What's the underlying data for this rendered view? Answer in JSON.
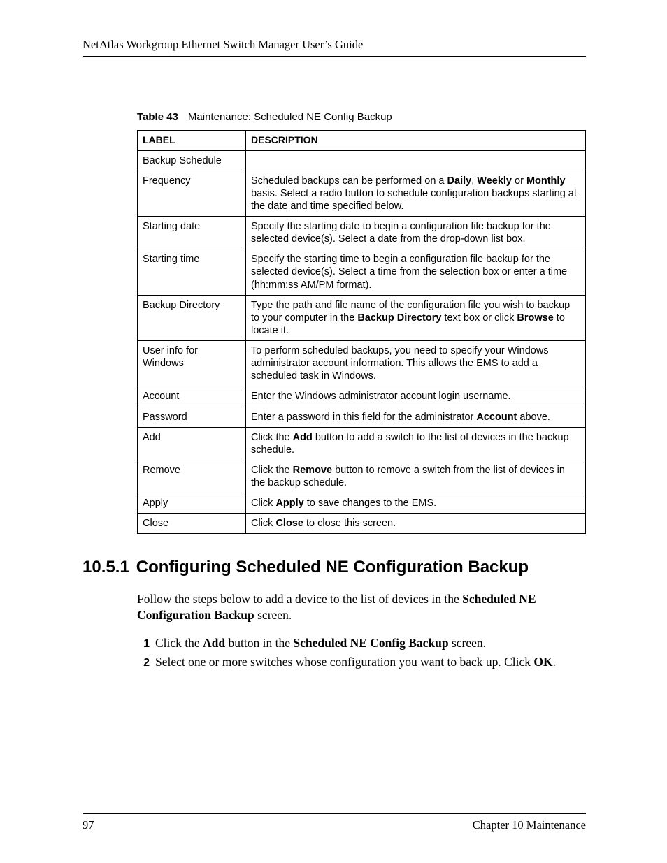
{
  "header": {
    "running": "NetAtlas Workgroup Ethernet Switch Manager User’s Guide"
  },
  "table": {
    "caption_prefix": "Table 43",
    "caption_text": "Maintenance: Scheduled NE Config Backup",
    "headers": {
      "label": "LABEL",
      "description": "DESCRIPTION"
    },
    "rows": [
      {
        "label": "Backup Schedule",
        "desc_html": ""
      },
      {
        "label": "Frequency",
        "desc_html": "Scheduled backups can be performed on a <span class='b'>Daily</span>, <span class='b'>Weekly</span> or <span class='b'>Monthly</span> basis. Select a radio button to schedule configuration backups starting at the date and time specified below."
      },
      {
        "label": "Starting date",
        "desc_html": "Specify the starting date to begin a configuration file backup for the selected device(s). Select a date from the drop-down list box."
      },
      {
        "label": "Starting time",
        "desc_html": "Specify the starting time to begin a configuration file backup for the selected device(s). Select a time from the selection box or enter a time (hh:mm:ss AM/PM format)."
      },
      {
        "label": "Backup Directory",
        "desc_html": "Type the path and file name of the configuration file you wish to backup to your computer in the <span class='b'>Backup Directory</span> text box or click <span class='b'>Browse</span> to locate it."
      },
      {
        "label": "User info for Windows",
        "desc_html": "To perform scheduled backups, you need to specify your Windows administrator account information. This allows the EMS to add a scheduled task in Windows."
      },
      {
        "label": "Account",
        "desc_html": "Enter the Windows administrator account login username."
      },
      {
        "label": "Password",
        "desc_html": "Enter a password in this field for the administrator <span class='b'>Account</span> above."
      },
      {
        "label": "Add",
        "desc_html": "Click the <span class='b'>Add</span> button to add a switch to the list of devices in the backup schedule."
      },
      {
        "label": "Remove",
        "desc_html": "Click the <span class='b'>Remove</span> button to remove a switch from the list of devices in the backup schedule."
      },
      {
        "label": "Apply",
        "desc_html": "Click <span class='b'>Apply</span> to save changes to the EMS."
      },
      {
        "label": "Close",
        "desc_html": "Click <span class='b'>Close</span> to close this screen."
      }
    ]
  },
  "section": {
    "number": "10.5.1",
    "title": "Configuring Scheduled NE Configuration Backup",
    "intro_html": "Follow the steps below to add a device to the list of devices in the <span class='b'>Scheduled NE Configuration Backup</span> screen.",
    "steps": [
      "Click the <span class='b'>Add</span> button in the <span class='b'>Scheduled NE Config Backup</span> screen.",
      "Select one or more switches whose configuration you want to back up. Click <span class='b'>OK</span>."
    ]
  },
  "footer": {
    "page_number": "97",
    "chapter": "Chapter 10 Maintenance"
  }
}
